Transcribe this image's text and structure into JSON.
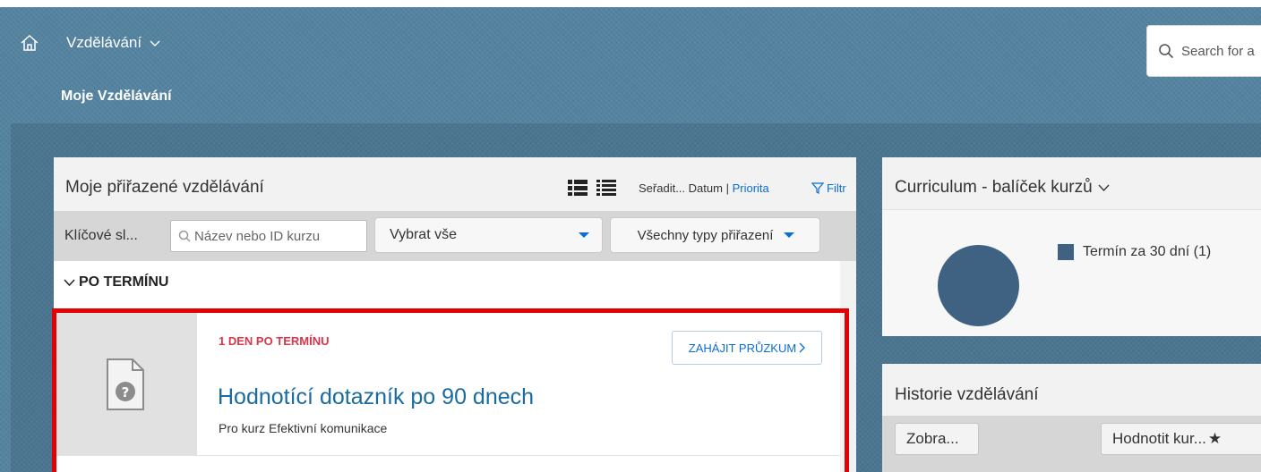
{
  "header": {
    "nav_title": "Vzdělávání",
    "page_subtitle": "Moje Vzdělávání",
    "search_placeholder": "Search for a"
  },
  "assigned": {
    "title": "Moje přiřazené vzdělávání",
    "sort_label": "Seřadit...",
    "sort_date": "Datum",
    "sort_separator": "|",
    "sort_priority": "Priorita",
    "filter_label": "Filtr",
    "keyword_label": "Klíčové sl...",
    "keyword_placeholder": "Název nebo ID kurzu",
    "select_all": "Vybrat vše",
    "assignment_types": "Všechny typy přiřazení",
    "group_heading": "PO TERMÍNU",
    "items": [
      {
        "status": "1 DEN PO TERMÍNU",
        "title": "Hodnotící dotazník po 90 dnech",
        "subtitle": "Pro kurz Efektivní komunikace",
        "action": "ZAHÁJIT PRŮZKUM",
        "icon": "survey-document-icon"
      }
    ]
  },
  "curriculum": {
    "title": "Curriculum - balíček kurzů",
    "legend": "Termín za 30 dní (1)"
  },
  "history": {
    "title": "Historie vzdělávání",
    "view_button": "Zobra...",
    "rate_button": "Hodnotit kur..."
  },
  "chart_data": {
    "type": "pie",
    "categories": [
      "Termín za 30 dní"
    ],
    "values": [
      1
    ]
  },
  "colors": {
    "accent": "#0a6ed1",
    "overdue": "#d9354b",
    "pie": "#3f6282",
    "highlight": "#e20000"
  }
}
